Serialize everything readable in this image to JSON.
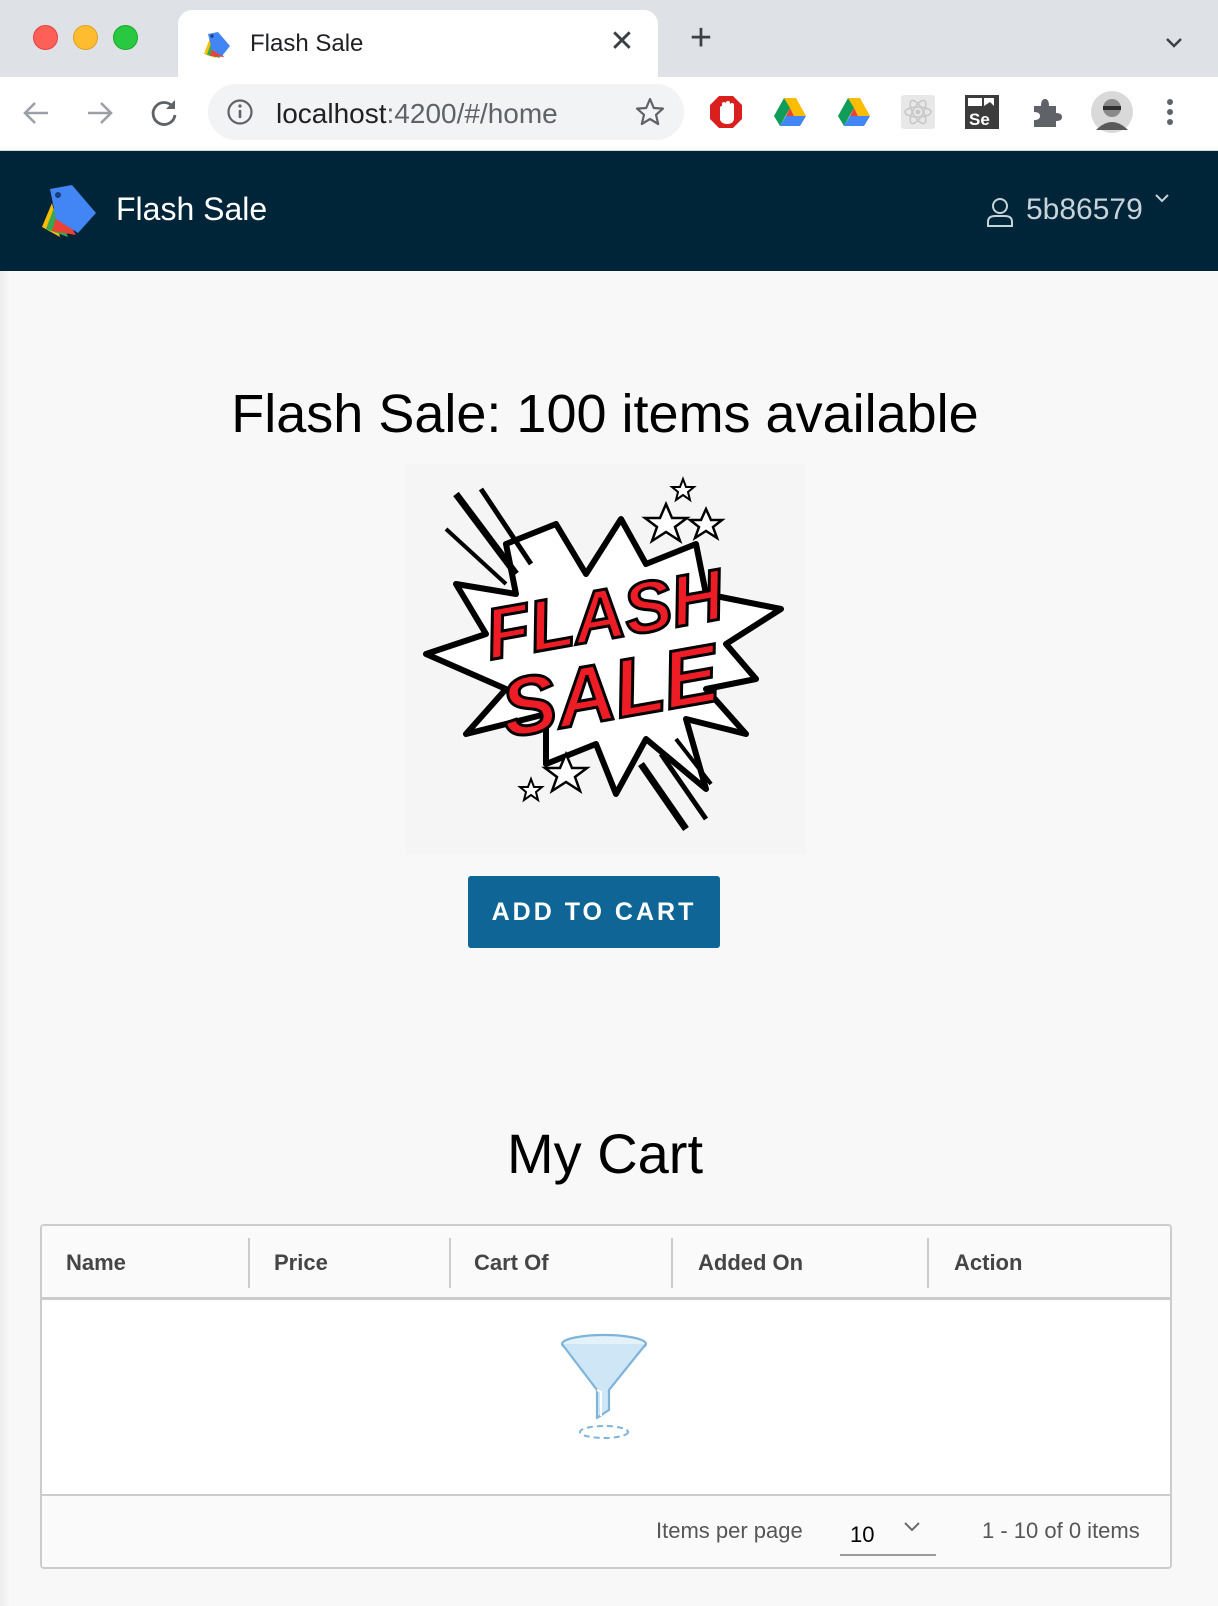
{
  "browser": {
    "tab_title": "Flash Sale",
    "close_symbol": "✕",
    "new_tab_symbol": "+",
    "url_host": "localhost",
    "url_path": ":4200/#/home",
    "extensions": [
      "adblock-icon",
      "google-drive-icon",
      "google-drive-icon",
      "react-devtools-icon",
      "selenium-ide-icon",
      "extensions-puzzle-icon",
      "profile-avatar"
    ]
  },
  "header": {
    "brand": "Flash Sale",
    "user": "5b86579",
    "background_color": "#002538"
  },
  "main": {
    "sale_title": "Flash Sale: 100 items available",
    "image_text_line1": "FLASH",
    "image_text_line2": "SALE",
    "add_to_cart_label": "ADD TO CART",
    "button_color": "#0e6596"
  },
  "cart": {
    "title": "My Cart",
    "columns": [
      "Name",
      "Price",
      "Cart Of",
      "Added On",
      "Action"
    ],
    "rows": [],
    "footer": {
      "items_per_page_label": "Items per page",
      "items_per_page_value": "10",
      "page_info": "1 - 10 of 0 items"
    }
  }
}
